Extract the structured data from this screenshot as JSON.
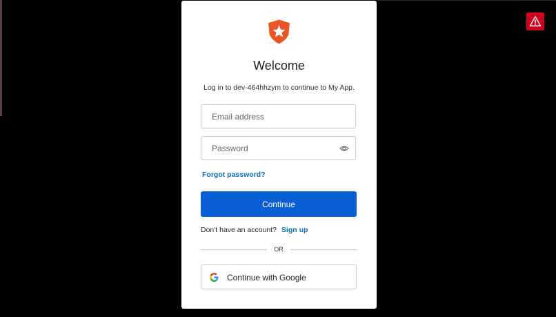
{
  "login": {
    "title": "Welcome",
    "subtitle": "Log in to dev-464hhzym to continue to My App.",
    "email_placeholder": "Email address",
    "password_placeholder": "Password",
    "forgot_password": "Forgot password?",
    "continue_label": "Continue",
    "no_account_text": "Don't have an account?",
    "signup_label": "Sign up",
    "divider_text": "OR",
    "google_label": "Continue with Google"
  },
  "icons": {
    "logo": "shield-star-logo",
    "password_toggle": "eye-icon",
    "google": "google-g-icon",
    "alert": "warning-triangle-icon"
  },
  "colors": {
    "brand": "#eb5424",
    "primary_button": "#0b5fd5",
    "link": "#0a6fb9",
    "alert_badge": "#d0021b",
    "backdrop": "#000000"
  }
}
